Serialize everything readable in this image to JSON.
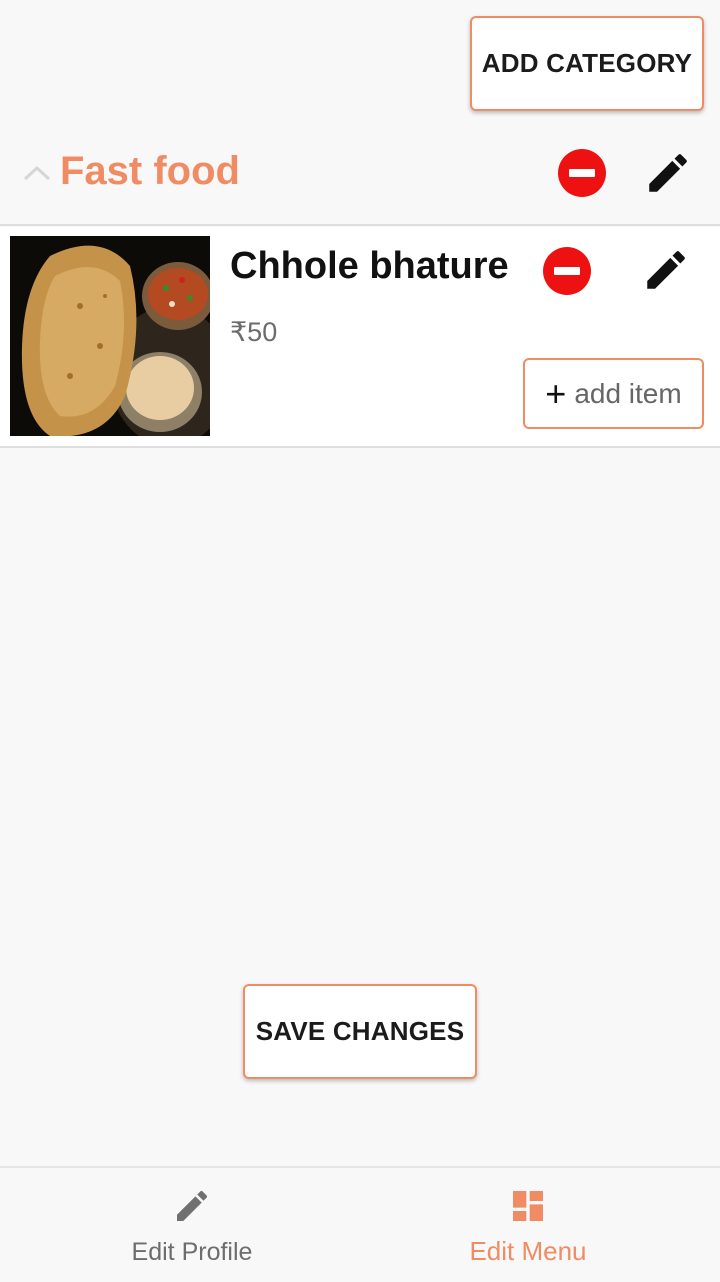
{
  "toolbar": {
    "add_category_label": "ADD CATEGORY"
  },
  "category": {
    "name": "Fast food",
    "icons": [
      "chevron-up-icon",
      "remove-icon",
      "edit-icon"
    ],
    "items": [
      {
        "name": "Chhole bhature",
        "price": "₹50",
        "image": "chhole-bhature-photo",
        "add_item_label": "add item"
      }
    ]
  },
  "actions": {
    "save_label": "SAVE CHANGES"
  },
  "bottom_nav": {
    "items": [
      {
        "label": "Edit Profile",
        "icon": "pencil-icon",
        "active": false
      },
      {
        "label": "Edit Menu",
        "icon": "dashboard-icon",
        "active": true
      }
    ]
  },
  "colors": {
    "accent": "#f08c64",
    "remove": "#ee1111",
    "background": "#f8f8f8"
  }
}
